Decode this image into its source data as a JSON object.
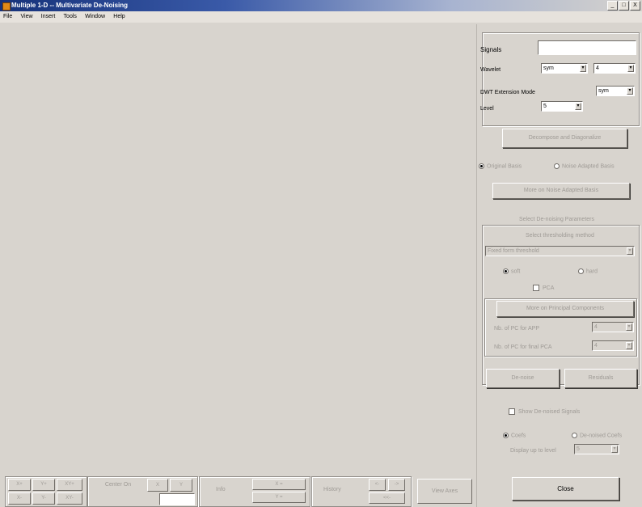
{
  "window": {
    "title": "Multiple 1-D -- Multivariate De-Noising",
    "buttons": [
      "_",
      "□",
      "X"
    ]
  },
  "menu": [
    "File",
    "View",
    "Insert",
    "Tools",
    "Window",
    "Help"
  ],
  "panel": {
    "signals_label": "Signals",
    "signals_value": "",
    "wavelet_label": "Wavelet",
    "wavelet_family": "sym",
    "wavelet_number": "4",
    "dwt_mode_label": "DWT Extension Mode",
    "dwt_mode": "sym",
    "level_label": "Level",
    "level_value": "5",
    "decompose_button": "Decompose and Diagonalize",
    "basis_original": "Original Basis",
    "basis_noise": "Noise Adapted Basis",
    "more_noise_button": "More on Noise Adapted Basis",
    "select_params": "Select De-noising Parameters",
    "select_method": "Select thresholding method",
    "method": "Fixed form threshold",
    "soft": "soft",
    "hard": "hard",
    "pca": "PCA",
    "more_pca_button": "More on Principal Components",
    "pc_app_label": "Nb. of PC for APP",
    "pc_app_value": "4",
    "pc_final_label": "Nb. of PC for final PCA",
    "pc_final_value": "4",
    "denoise_button": "De-noise",
    "residuals_button": "Residuals",
    "show_denoised": "Show De-noised Signals",
    "coefs": "Coefs",
    "denoised_coefs": "De-noised Coefs",
    "display_level_label": "Display up to level",
    "display_level_value": "5",
    "close_button": "Close"
  },
  "bottom": {
    "zoom": [
      "X+",
      "Y+",
      "XY+",
      "X-",
      "Y-",
      "XY-"
    ],
    "center_on": "Center On",
    "center_x": "X",
    "center_y": "Y",
    "info": "Info",
    "x_eq": "X =",
    "y_eq": "Y =",
    "history": "History",
    "hist_back": "<-",
    "hist_fwd": "->",
    "hist_both": "<<-",
    "view_axes": "View Axes"
  }
}
